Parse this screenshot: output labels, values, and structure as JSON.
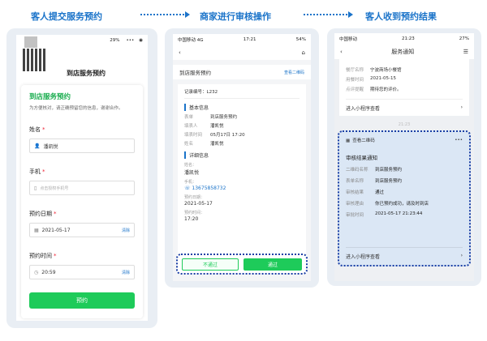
{
  "header": {
    "step1": "客人提交服务预约",
    "step2": "商家进行审核操作",
    "step3": "客人收到预约结果"
  },
  "phone1": {
    "battery": "29%",
    "brand_title": "到店服务预约",
    "form_heading": "到店服务预约",
    "form_subtitle": "为方便核对，请正确预留您的信息，谢谢合作。",
    "name_label": "姓名",
    "name_value": "潘凯悦",
    "phone_label": "手机",
    "phone_placeholder": "点击授权手机号",
    "date_label": "预约日期",
    "date_value": "2021-05-17",
    "time_label": "预约时间",
    "time_value": "20:59",
    "clear_label": "清除",
    "required_mark": "*",
    "submit_label": "预约"
  },
  "phone2": {
    "carrier": "中国移动  4G",
    "time": "17:21",
    "battery": "54%",
    "page_title": "到店服务预约",
    "qr_link": "查看二维码",
    "record_no": "记录编号：L232",
    "basic_title": "基本信息",
    "basic_rows": [
      {
        "k": "表单",
        "v": "到店服务预约"
      },
      {
        "k": "填表人",
        "v": "潘凯悦"
      },
      {
        "k": "填表时间",
        "v": "05月17日 17:20"
      },
      {
        "k": "姓名",
        "v": "潘凯悦"
      }
    ],
    "detail_title": "详细信息",
    "name_k": "姓名：",
    "name_v": "潘凯悦",
    "phone_k": "手机：",
    "phone_v": "13675858732",
    "date_k": "预约日期：",
    "date_v": "2021-05-17",
    "time_k": "预约时间：",
    "time_v": "17:20",
    "reject_label": "不通过",
    "approve_label": "通过"
  },
  "phone3": {
    "carrier": "中国移动",
    "time": "21:23",
    "battery": "27%",
    "nav_title": "服务通知",
    "info_rows": [
      {
        "k": "餐厅名称",
        "v": "宁波商场小餐馆"
      },
      {
        "k": "用餐时间",
        "v": "2021-05-15"
      },
      {
        "k": "点评提醒",
        "v": "期待您的评价。"
      }
    ],
    "enter_label": "进入小程序查看",
    "msg_time": "21:23",
    "qr_label": "查看二维码",
    "result_title": "审核结果通知",
    "result_rows": [
      {
        "k": "二维码名称",
        "v": "到店服务预约"
      },
      {
        "k": "表单名称",
        "v": "到店服务预约"
      },
      {
        "k": "审核结果",
        "v": "通过"
      },
      {
        "k": "审核理由",
        "v": "你已预约成功，请及时到店"
      },
      {
        "k": "审批时间",
        "v": "2021-05-17 21:23:44"
      }
    ],
    "result_enter_label": "进入小程序查看"
  }
}
